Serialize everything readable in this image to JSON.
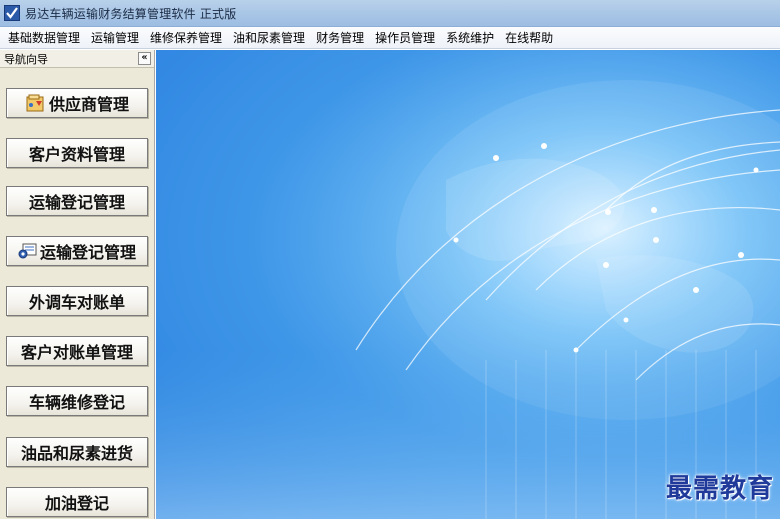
{
  "window": {
    "title": "易达车辆运输财务结算管理软件   正式版"
  },
  "menu": [
    "基础数据管理",
    "运输管理",
    "维修保养管理",
    "油和尿素管理",
    "财务管理",
    "操作员管理",
    "系统维护",
    "在线帮助"
  ],
  "nav": {
    "title": "导航向导",
    "collapse_label": "«",
    "buttons": [
      {
        "label": "供应商管理",
        "icon": "supplier-icon"
      },
      {
        "label": "客户资料管理",
        "icon": ""
      },
      {
        "label": "运输登记管理",
        "icon": ""
      },
      {
        "label": "运输登记管理",
        "icon": "transport-register-icon"
      },
      {
        "label": "外调车对账单",
        "icon": ""
      },
      {
        "label": "客户对账单管理",
        "icon": ""
      },
      {
        "label": "车辆维修登记",
        "icon": ""
      },
      {
        "label": "油品和尿素进货",
        "icon": ""
      },
      {
        "label": "加油登记",
        "icon": ""
      }
    ]
  },
  "watermark": "最需教育",
  "colors": {
    "titlebar": "#a9c6e6",
    "panel": "#ece9d8",
    "main_background": "#3f97e8",
    "watermark": "#1f3a9a"
  }
}
